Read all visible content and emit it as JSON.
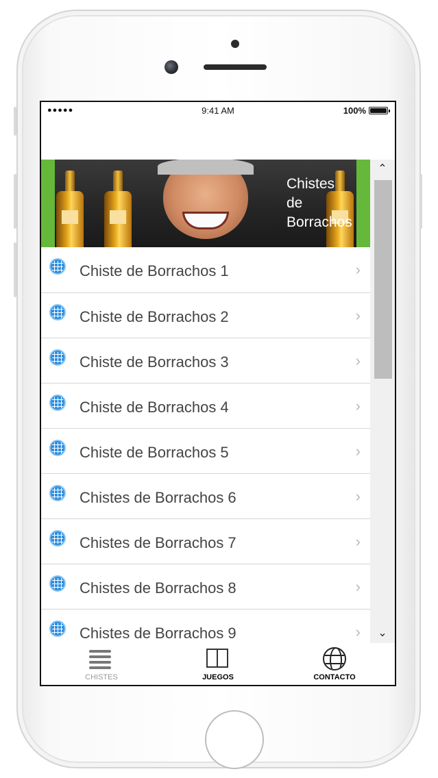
{
  "status_bar": {
    "signal": "●●●●●",
    "time": "9:41 AM",
    "battery": "100%"
  },
  "banner": {
    "title_line1": "Chistes",
    "title_line2": "de",
    "title_line3": "Borrachos"
  },
  "scrollbar": {
    "up": "⌃",
    "down": "⌄"
  },
  "list": {
    "items": [
      {
        "label": "Chiste de Borrachos 1"
      },
      {
        "label": "Chiste de Borrachos 2"
      },
      {
        "label": "Chiste de Borrachos 3"
      },
      {
        "label": "Chiste de Borrachos 4"
      },
      {
        "label": "Chiste de Borrachos 5"
      },
      {
        "label": "Chistes de Borrachos 6"
      },
      {
        "label": "Chistes de Borrachos 7"
      },
      {
        "label": "Chistes de Borrachos 8"
      },
      {
        "label": "Chistes de Borrachos 9"
      }
    ],
    "chevron": "›",
    "item_icon": "globe-icon"
  },
  "tabs": [
    {
      "label": "CHISTES",
      "icon": "list-icon",
      "color": "#9a9a9a"
    },
    {
      "label": "JUEGOS",
      "icon": "book-icon",
      "color": "#111111"
    },
    {
      "label": "CONTACTO",
      "icon": "globe-icon",
      "color": "#111111"
    }
  ],
  "colors": {
    "banner_green": "#65b83a",
    "list_icon_blue": "#2f8fe0"
  }
}
